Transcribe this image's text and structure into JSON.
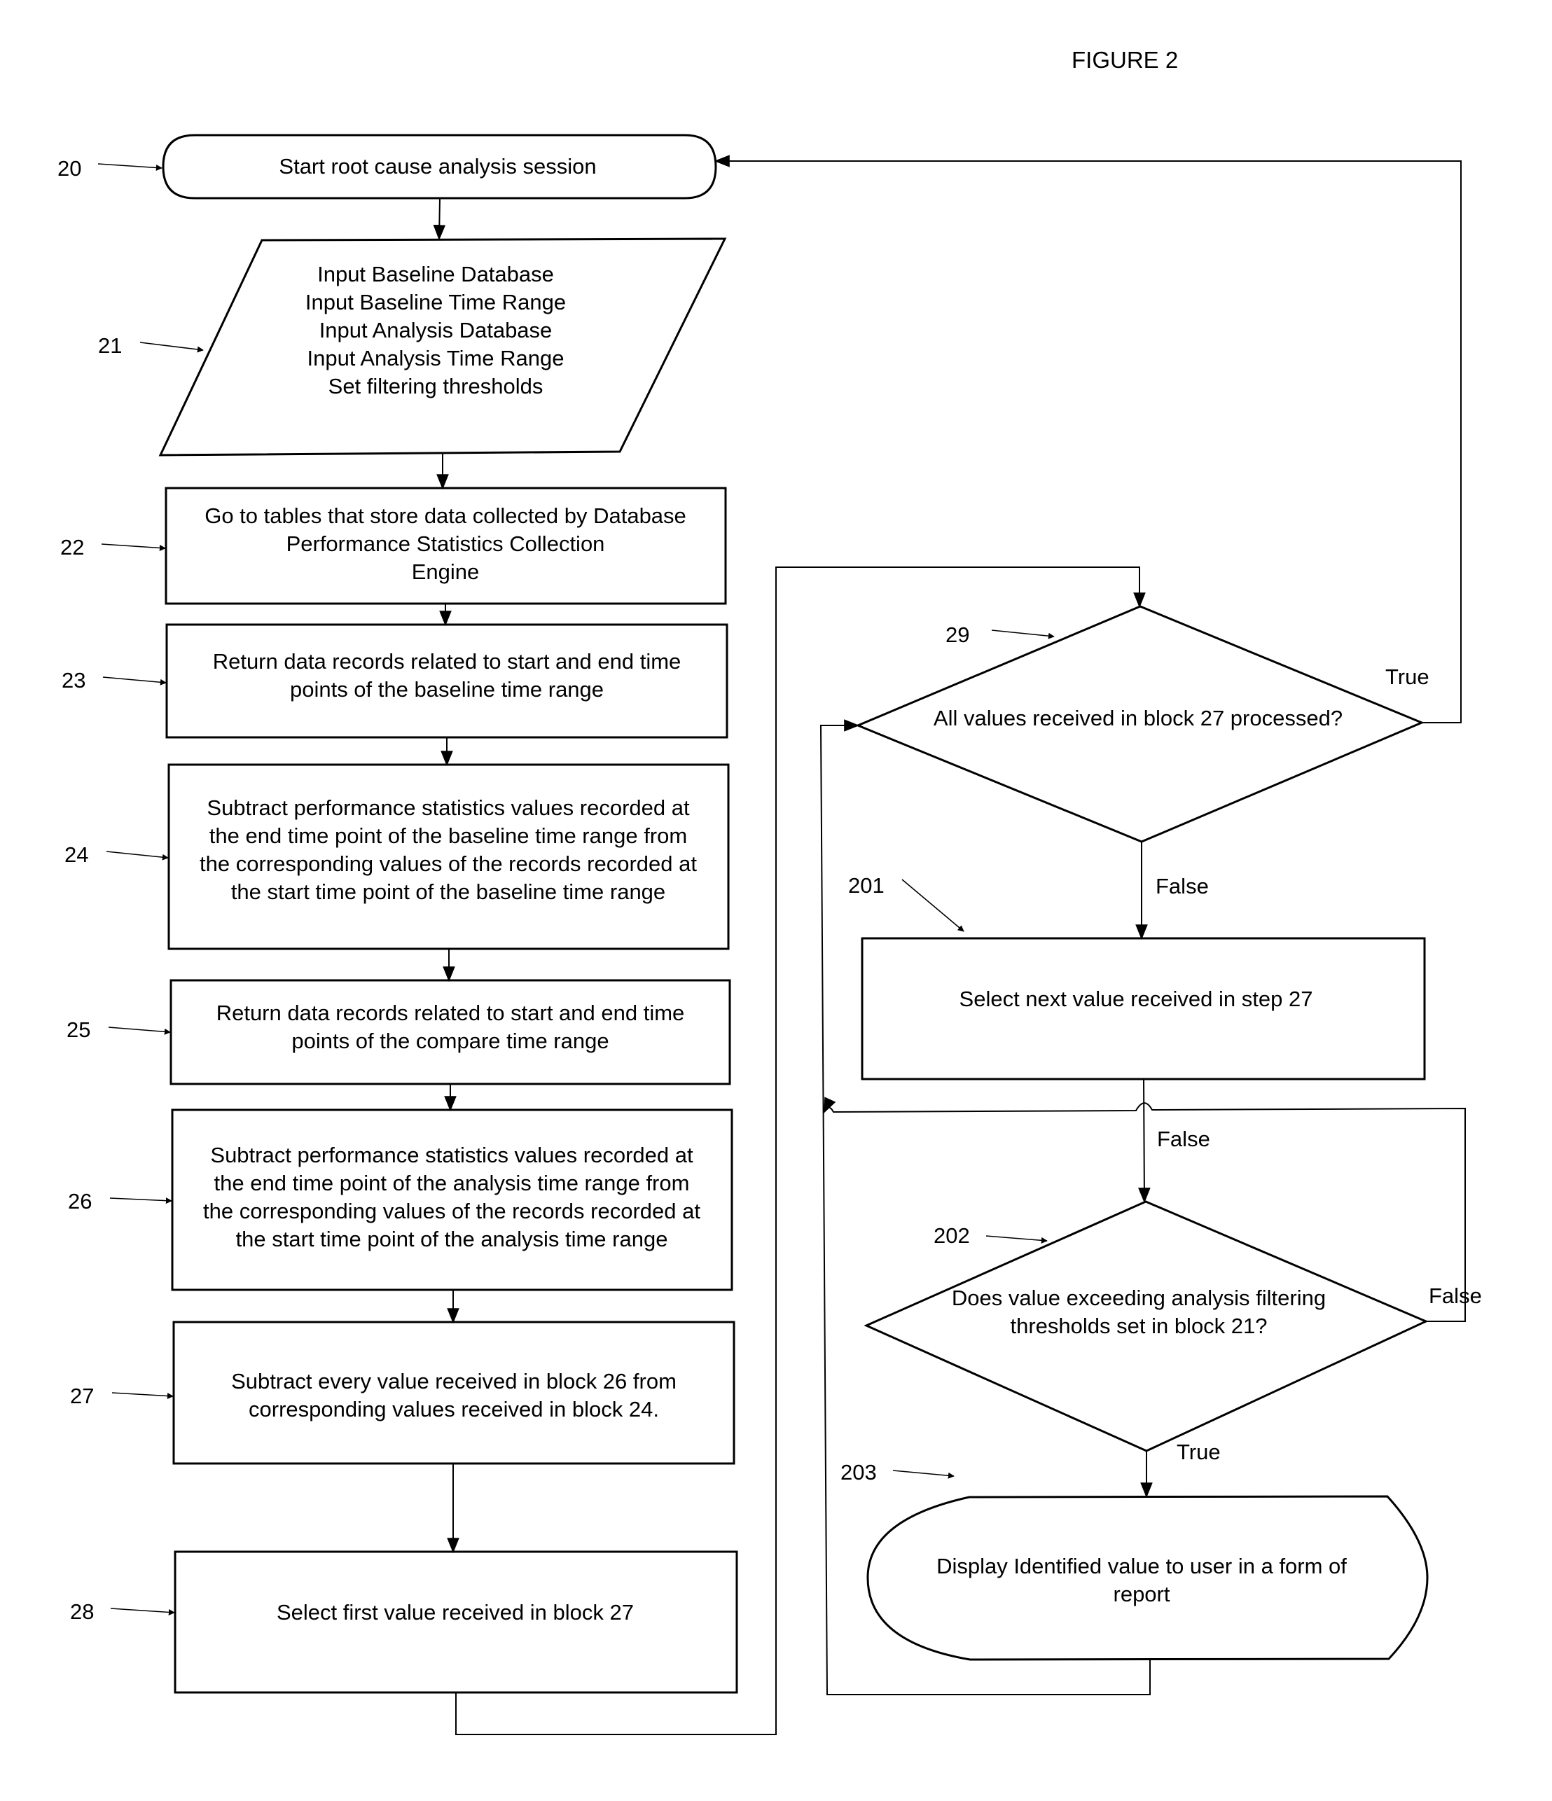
{
  "figure": {
    "title": "FIGURE 2"
  },
  "blocks": {
    "b20": {
      "ref": "20",
      "lines": [
        "Start root cause analysis session"
      ]
    },
    "b21": {
      "ref": "21",
      "lines": [
        "Input Baseline Database",
        "Input Baseline Time Range",
        "Input Analysis Database",
        "Input Analysis Time Range",
        "Set filtering thresholds"
      ]
    },
    "b22": {
      "ref": "22",
      "lines": [
        "Go to tables that store data collected by Database",
        "Performance Statistics Collection",
        "Engine"
      ]
    },
    "b23": {
      "ref": "23",
      "lines": [
        "Return data records related to start and end time",
        "points of the baseline time range"
      ]
    },
    "b24": {
      "ref": "24",
      "lines": [
        "Subtract performance statistics values recorded at",
        "the end time point of the baseline time range from",
        "the corresponding values of the records recorded at",
        "the start time point of the baseline time range"
      ]
    },
    "b25": {
      "ref": "25",
      "lines": [
        "Return data records related to start and end time",
        "points of the compare time range"
      ]
    },
    "b26": {
      "ref": "26",
      "lines": [
        "Subtract performance statistics values recorded at",
        "the end time point of the analysis time range from",
        "the corresponding values of the records recorded at",
        "the start time point of the analysis time range"
      ]
    },
    "b27": {
      "ref": "27",
      "lines": [
        "Subtract every value received in block 26 from",
        "corresponding values received in block 24."
      ]
    },
    "b28": {
      "ref": "28",
      "lines": [
        "Select first value received in block 27"
      ]
    },
    "b29": {
      "ref": "29",
      "lines": [
        "All values received in block 27 processed?"
      ]
    },
    "b201": {
      "ref": "201",
      "lines": [
        "Select next value received in step 27"
      ]
    },
    "b202": {
      "ref": "202",
      "lines": [
        "Does value exceeding analysis filtering",
        "thresholds set in block  21?"
      ]
    },
    "b203": {
      "ref": "203",
      "lines": [
        "Display Identified value to user in a form of",
        "report"
      ]
    }
  },
  "edge_labels": {
    "b29_true": "True",
    "b29_false": "False",
    "b201_false": "False",
    "b202_false": "False",
    "b202_true": "True"
  }
}
